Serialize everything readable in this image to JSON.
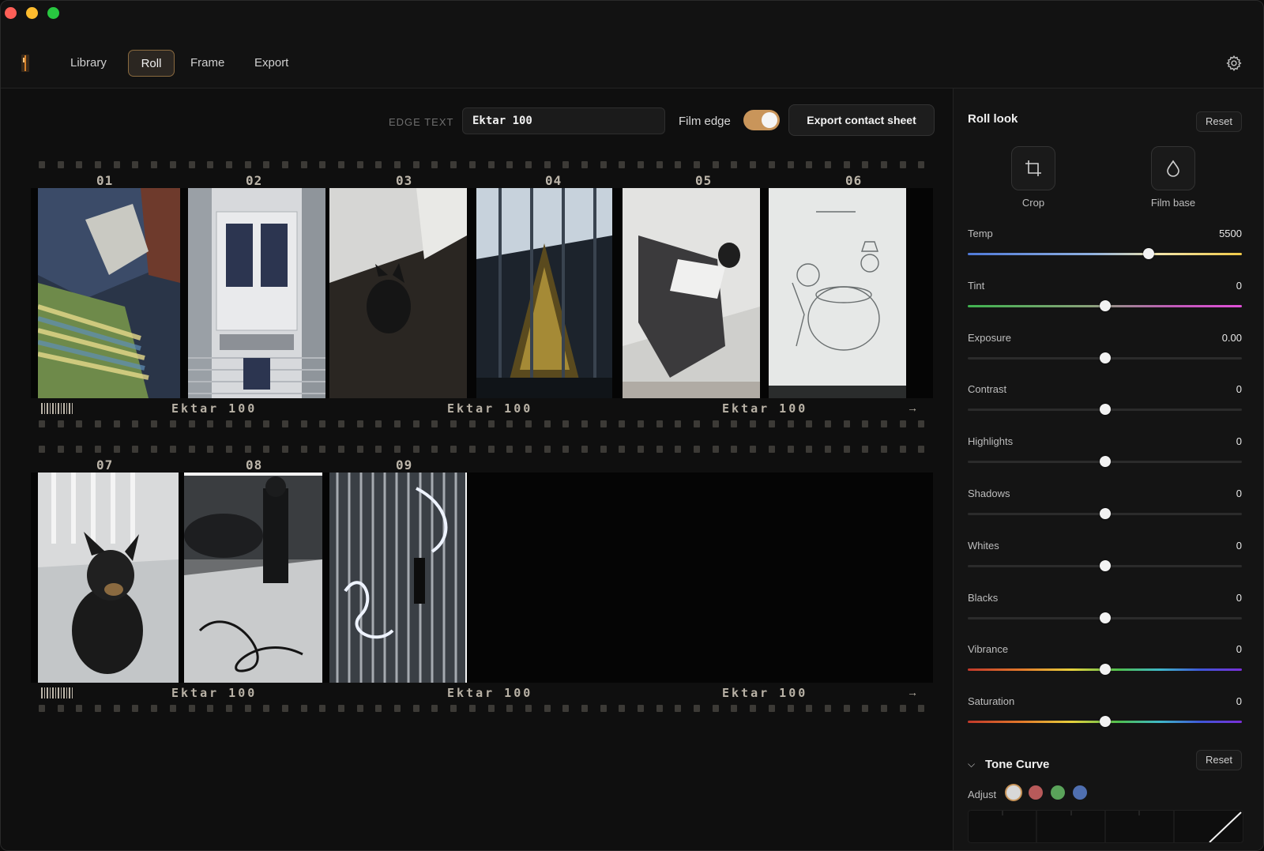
{
  "app": {
    "tabs": [
      {
        "label": "Library",
        "active": false
      },
      {
        "label": "Roll",
        "active": true
      },
      {
        "label": "Frame",
        "active": false
      },
      {
        "label": "Export",
        "active": false
      }
    ],
    "accent_color": "#c9955a"
  },
  "roll_toolbar": {
    "edge_text_label": "EDGE TEXT",
    "edge_text_value": "Ektar 100",
    "film_edge_label": "Film edge",
    "film_edge_on": true,
    "export_button": "Export contact sheet"
  },
  "strips": [
    {
      "frame_numbers": [
        "01",
        "02",
        "03",
        "04",
        "05",
        "06"
      ],
      "edge_texts": [
        "Ektar 100",
        "Ektar 100",
        "Ektar 100"
      ],
      "arrow": "→"
    },
    {
      "frame_numbers": [
        "07",
        "08",
        "09"
      ],
      "edge_texts": [
        "Ektar 100",
        "Ektar 100",
        "Ektar 100"
      ],
      "arrow": "→"
    }
  ],
  "sidebar": {
    "title": "Roll look",
    "reset_label": "Reset",
    "tools": [
      {
        "label": "Crop",
        "icon": "crop-icon"
      },
      {
        "label": "Film base",
        "icon": "drop-icon"
      }
    ],
    "sliders": [
      {
        "name": "Temp",
        "value": "5500",
        "position": 0.66,
        "track": "temp"
      },
      {
        "name": "Tint",
        "value": "0",
        "position": 0.5,
        "track": "tint"
      },
      {
        "name": "Exposure",
        "value": "0.00",
        "position": 0.5,
        "track": "plain"
      },
      {
        "name": "Contrast",
        "value": "0",
        "position": 0.5,
        "track": "plain"
      },
      {
        "name": "Highlights",
        "value": "0",
        "position": 0.5,
        "track": "plain"
      },
      {
        "name": "Shadows",
        "value": "0",
        "position": 0.5,
        "track": "plain"
      },
      {
        "name": "Whites",
        "value": "0",
        "position": 0.5,
        "track": "plain"
      },
      {
        "name": "Blacks",
        "value": "0",
        "position": 0.5,
        "track": "plain"
      },
      {
        "name": "Vibrance",
        "value": "0",
        "position": 0.5,
        "track": "rainbow"
      },
      {
        "name": "Saturation",
        "value": "0",
        "position": 0.5,
        "track": "rainbow"
      }
    ],
    "tone_curve": {
      "title": "Tone Curve",
      "reset_label": "Reset",
      "adjust_label": "Adjust",
      "channels": [
        "#d8d8d8",
        "#b85a5a",
        "#5aa35a",
        "#4f6fb0"
      ],
      "selected_channel": 0
    }
  }
}
